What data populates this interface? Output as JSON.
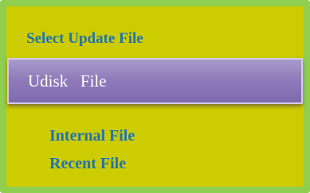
{
  "menu": {
    "title": "Select Update File",
    "items": [
      {
        "label": "Udisk   File",
        "selected": true
      },
      {
        "label": "Internal File",
        "selected": false
      },
      {
        "label": "Recent File",
        "selected": false
      }
    ]
  },
  "colors": {
    "background": "#cccc00",
    "border": "#8fce4f",
    "text": "#1e72b4",
    "selected_bg": "#8f7cba",
    "selected_text": "#ffffff"
  }
}
